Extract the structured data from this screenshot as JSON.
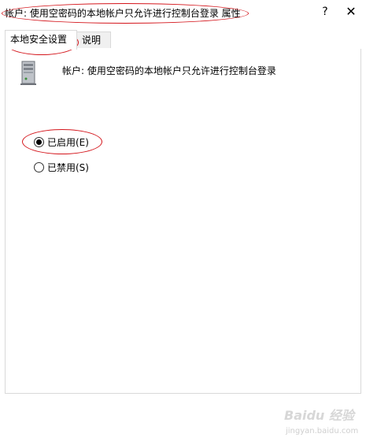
{
  "window": {
    "title": "帐户: 使用空密码的本地帐户只允许进行控制台登录 属性",
    "help_label": "?",
    "close_label": "✕"
  },
  "tabs": [
    {
      "label": "本地安全设置",
      "active": true
    },
    {
      "label": "说明",
      "active": false
    }
  ],
  "policy": {
    "icon": "server-tower-icon",
    "name": "帐户: 使用空密码的本地帐户只允许进行控制台登录"
  },
  "options": [
    {
      "label": "已启用(E)",
      "selected": true
    },
    {
      "label": "已禁用(S)",
      "selected": false
    }
  ],
  "watermark": {
    "main": "Baidu 经验",
    "sub": "jingyan.baidu.com"
  },
  "colors": {
    "annotation": "#d4151b",
    "border": "#d9d9d9"
  }
}
